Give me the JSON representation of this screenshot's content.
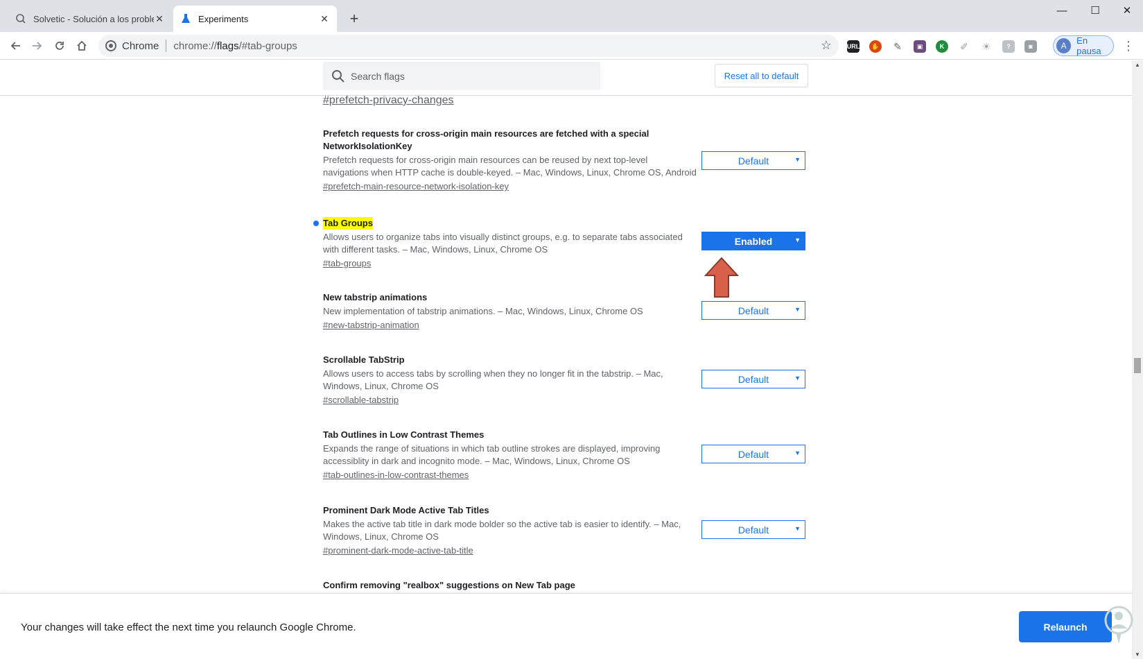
{
  "browser": {
    "tabs": [
      {
        "title": "Solvetic - Solución a los problemas",
        "active": false
      },
      {
        "title": "Experiments",
        "active": true
      }
    ],
    "address": {
      "site": "Chrome",
      "url_prefix": "chrome://",
      "url_bold": "flags",
      "url_suffix": "/#tab-groups"
    },
    "profile": {
      "initial": "A",
      "label": "En pausa"
    }
  },
  "flags": {
    "search_placeholder": "Search flags",
    "reset_label": "Reset all to default",
    "top_link": "#prefetch-privacy-changes",
    "experiments": [
      {
        "name_line1": "Prefetch requests for cross-origin main resources are fetched with a special",
        "name_line2": "NetworkIsolationKey",
        "desc_line1": "Prefetch requests for cross-origin main resources can be reused by next top-level",
        "desc_line2": "navigations when HTTP cache is double-keyed. – Mac, Windows, Linux, Chrome OS, Android",
        "link": "#prefetch-main-resource-network-isolation-key",
        "value": "Default"
      },
      {
        "name_line1": "Tab Groups",
        "desc_line1": "Allows users to organize tabs into visually distinct groups, e.g. to separate tabs associated",
        "desc_line2": "with different tasks. – Mac, Windows, Linux, Chrome OS",
        "link": "#tab-groups",
        "value": "Enabled"
      },
      {
        "name_line1": "New tabstrip animations",
        "desc_line1": "New implementation of tabstrip animations. – Mac, Windows, Linux, Chrome OS",
        "link": "#new-tabstrip-animation",
        "value": "Default"
      },
      {
        "name_line1": "Scrollable TabStrip",
        "desc_line1": "Allows users to access tabs by scrolling when they no longer fit in the tabstrip. – Mac,",
        "desc_line2": "Windows, Linux, Chrome OS",
        "link": "#scrollable-tabstrip",
        "value": "Default"
      },
      {
        "name_line1": "Tab Outlines in Low Contrast Themes",
        "desc_line1": "Expands the range of situations in which tab outline strokes are displayed, improving",
        "desc_line2": "accessiblity in dark and incognito mode. – Mac, Windows, Linux, Chrome OS",
        "link": "#tab-outlines-in-low-contrast-themes",
        "value": "Default"
      },
      {
        "name_line1": "Prominent Dark Mode Active Tab Titles",
        "desc_line1": "Makes the active tab title in dark mode bolder so the active tab is easier to identify. – Mac,",
        "desc_line2": "Windows, Linux, Chrome OS",
        "link": "#prominent-dark-mode-active-tab-title",
        "value": "Default"
      },
      {
        "name_line1": "Confirm removing \"realbox\" suggestions on New Tab page"
      }
    ]
  },
  "footer": {
    "message": "Your changes will take effect the next time you relaunch Google Chrome.",
    "relaunch_label": "Relaunch"
  },
  "colors": {
    "accent": "#1a73e8",
    "highlight": "#ffff00",
    "arrow": "#d9604a"
  }
}
